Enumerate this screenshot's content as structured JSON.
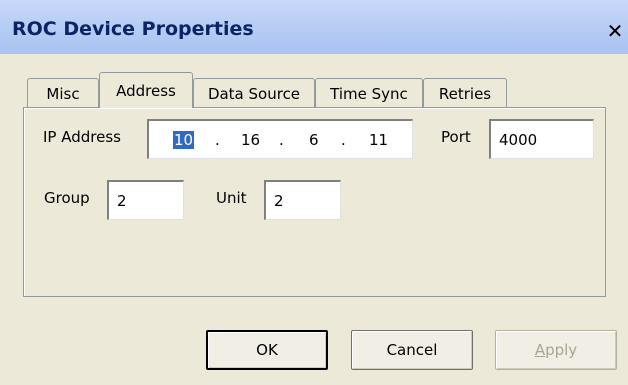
{
  "window": {
    "title": "ROC Device Properties",
    "close_icon": "close-icon"
  },
  "tabs": [
    {
      "label": "Misc",
      "active": false
    },
    {
      "label": "Address",
      "active": true
    },
    {
      "label": "Data Source",
      "active": false
    },
    {
      "label": "Time Sync",
      "active": false
    },
    {
      "label": "Retries",
      "active": false
    }
  ],
  "address": {
    "ip_label": "IP Address",
    "ip_octets": [
      "10",
      "16",
      "6",
      "11"
    ],
    "ip_separator": ".",
    "port_label": "Port",
    "port_value": "4000",
    "group_label": "Group",
    "group_value": "2",
    "unit_label": "Unit",
    "unit_value": "2"
  },
  "buttons": {
    "ok": "OK",
    "cancel": "Cancel",
    "apply_accel": "A",
    "apply_rest": "pply"
  },
  "colors": {
    "selection": "#316ac5",
    "titlebar": "#b7cdf5",
    "dialog_bg": "#ece9d8"
  }
}
